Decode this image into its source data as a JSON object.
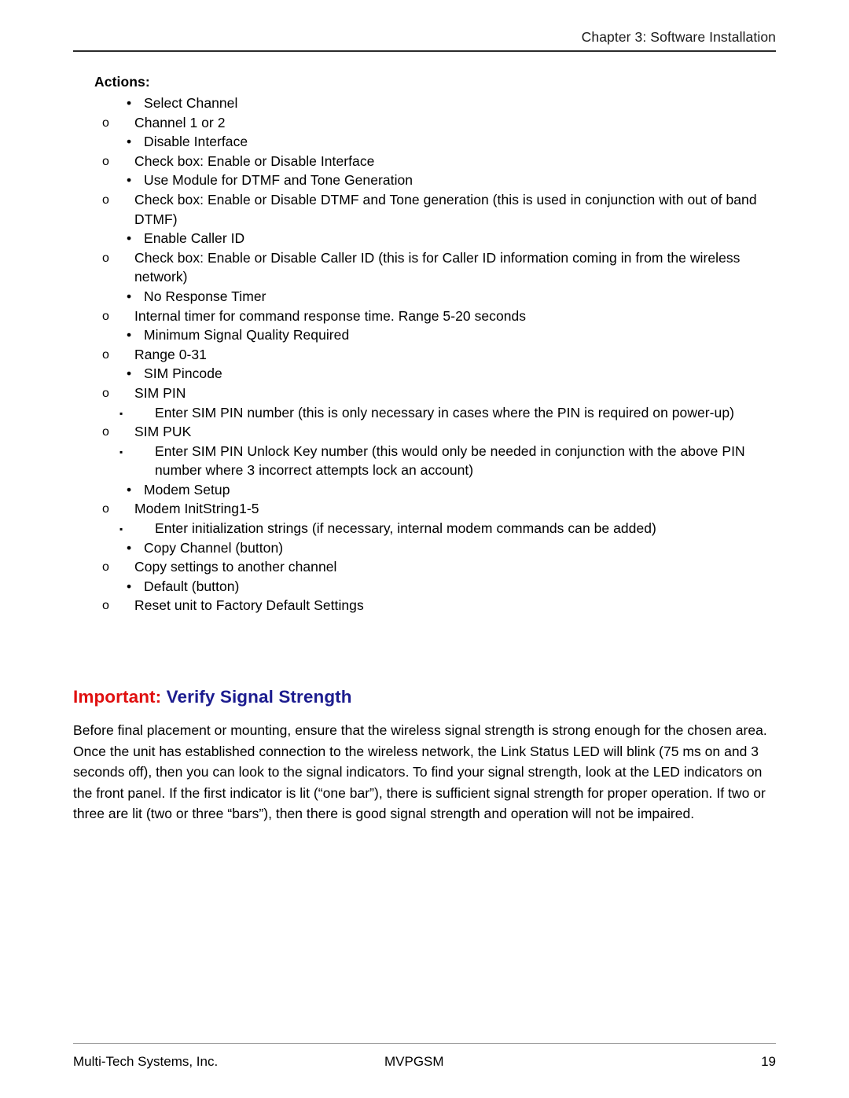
{
  "header": {
    "chapter_title": "Chapter 3: Software Installation"
  },
  "actions": {
    "label": "Actions:",
    "items": [
      {
        "level": 1,
        "bullet": "disc-bullet",
        "text": "Select Channel"
      },
      {
        "level": 2,
        "bullet": "circle-bullet",
        "text": "Channel 1 or 2"
      },
      {
        "level": 1,
        "bullet": "disc-bullet",
        "text": "Disable Interface"
      },
      {
        "level": 2,
        "bullet": "circle-bullet",
        "text": "Check box: Enable or Disable Interface"
      },
      {
        "level": 1,
        "bullet": "disc-bullet",
        "text": "Use Module for DTMF and Tone Generation"
      },
      {
        "level": 2,
        "bullet": "circle-bullet",
        "text": "Check box: Enable or Disable DTMF and Tone generation (this is used in conjunction with out of band DTMF)"
      },
      {
        "level": 1,
        "bullet": "disc-bullet",
        "text": "Enable Caller ID"
      },
      {
        "level": 2,
        "bullet": "circle-bullet",
        "text": "Check box: Enable or Disable Caller ID (this is for Caller ID information coming in from the wireless network)"
      },
      {
        "level": 1,
        "bullet": "disc-bullet",
        "text": "No Response Timer"
      },
      {
        "level": 2,
        "bullet": "circle-bullet",
        "text": "Internal timer for command response time. Range 5-20 seconds"
      },
      {
        "level": 1,
        "bullet": "disc-bullet",
        "text": "Minimum Signal Quality Required"
      },
      {
        "level": 2,
        "bullet": "circle-bullet",
        "text": "Range 0-31"
      },
      {
        "level": 1,
        "bullet": "disc-bullet",
        "text": "SIM Pincode"
      },
      {
        "level": 2,
        "bullet": "circle-bullet",
        "text": "SIM PIN"
      },
      {
        "level": 3,
        "bullet": "square-bullet",
        "text": "Enter SIM PIN number (this is only necessary in cases where the PIN is required on power-up)"
      },
      {
        "level": 2,
        "bullet": "circle-bullet",
        "text": "SIM PUK"
      },
      {
        "level": 3,
        "bullet": "square-bullet",
        "text": "Enter SIM PIN Unlock Key number (this would only be needed in conjunction with the above PIN number where 3 incorrect attempts lock an account)"
      },
      {
        "level": 1,
        "bullet": "disc-bullet",
        "text": "Modem Setup"
      },
      {
        "level": 2,
        "bullet": "circle-bullet",
        "text": "Modem InitString1-5"
      },
      {
        "level": 3,
        "bullet": "square-bullet",
        "text": "Enter initialization strings (if necessary, internal modem commands can be added)"
      },
      {
        "level": 1,
        "bullet": "disc-bullet",
        "text": "Copy Channel (button)"
      },
      {
        "level": 2,
        "bullet": "circle-bullet",
        "text": "Copy settings to another channel"
      },
      {
        "level": 1,
        "bullet": "disc-bullet",
        "text": "Default (button)"
      },
      {
        "level": 2,
        "bullet": "circle-bullet",
        "text": "Reset unit to Factory Default Settings"
      }
    ]
  },
  "section": {
    "heading_important": "Important:",
    "heading_rest": "Verify Signal Strength",
    "paragraph": "Before final placement or mounting, ensure that the wireless signal strength is strong enough for the chosen area. Once the unit has established connection to the wireless network, the Link Status LED will blink (75 ms on and 3 seconds off), then you can look to the signal indicators. To find your signal strength, look at the LED indicators on the front panel. If the first indicator is lit (“one bar”), there is sufficient signal strength for proper operation. If two or three are lit (two or three “bars”), then there is good signal strength and operation will not be impaired."
  },
  "footer": {
    "company": "Multi-Tech Systems, Inc.",
    "product": "MVPGSM",
    "page_number": "19"
  },
  "colors": {
    "important_red": "#e01010",
    "heading_blue": "#1c1c8f",
    "header_rule": "#2b2b2b",
    "footer_rule": "#9a9a9a",
    "text": "#000000"
  },
  "glyphs": {
    "disc": "•",
    "circle": "o",
    "square": "▪"
  }
}
